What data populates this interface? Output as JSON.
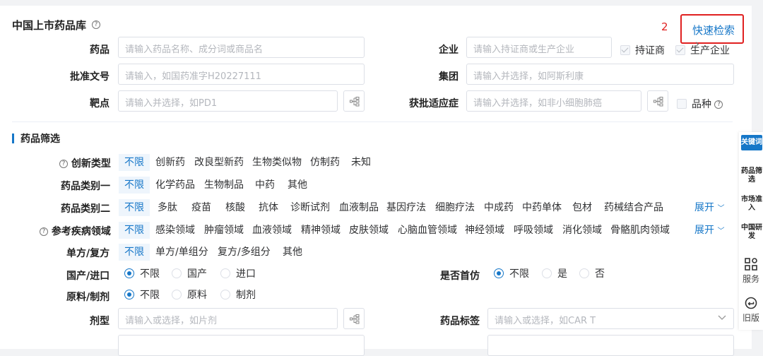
{
  "header": {
    "title": "中国上市药品库",
    "help": "?",
    "annotation": "2",
    "quick_search": "快速检索",
    "quick_search_arrow": "›"
  },
  "search": {
    "drug": {
      "label": "药品",
      "placeholder": "请输入药品名称、成分词或商品名"
    },
    "company": {
      "label": "企业",
      "placeholder": "请输入持证商或生产企业",
      "opt_holder": "持证商",
      "opt_manufacturer": "生产企业"
    },
    "approval": {
      "label": "批准文号",
      "placeholder": "请输入，如国药准字H20227111"
    },
    "group": {
      "label": "集团",
      "placeholder": "请输入并选择，如阿斯利康"
    },
    "target": {
      "label": "靶点",
      "placeholder": "请输入并选择，如PD1"
    },
    "indication": {
      "label": "获批适应症",
      "placeholder": "请输入并选择，如非小细胞肺癌",
      "variety": "品种"
    }
  },
  "filters": {
    "section_title": "药品筛选",
    "innovation": {
      "label": "创新类型",
      "options": [
        "不限",
        "创新药",
        "改良型新药",
        "生物类似物",
        "仿制药",
        "未知"
      ]
    },
    "cat1": {
      "label": "药品类别一",
      "options": [
        "不限",
        "化学药品",
        "生物制品",
        "中药",
        "其他"
      ]
    },
    "cat2": {
      "label": "药品类别二",
      "options": [
        "不限",
        "多肽",
        "疫苗",
        "核酸",
        "抗体",
        "诊断试剂",
        "血液制品",
        "基因疗法",
        "细胞疗法",
        "中成药",
        "中药单体",
        "包材",
        "药械结合产品"
      ],
      "expand": "展开"
    },
    "disease": {
      "label": "参考疾病领域",
      "options": [
        "不限",
        "感染领域",
        "肿瘤领域",
        "血液领域",
        "精神领域",
        "皮肤领域",
        "心脑血管领域",
        "神经领域",
        "呼吸领域",
        "消化领域",
        "骨骼肌肉领域"
      ],
      "expand": "展开"
    },
    "formula": {
      "label": "单方/复方",
      "options": [
        "不限",
        "单方/单组分",
        "复方/多组分",
        "其他"
      ]
    },
    "origin": {
      "label": "国产/进口",
      "options": [
        "不限",
        "国产",
        "进口"
      ]
    },
    "first_generic": {
      "label": "是否首仿",
      "options": [
        "不限",
        "是",
        "否"
      ]
    },
    "material": {
      "label": "原料/制剂",
      "options": [
        "不限",
        "原料",
        "制剂"
      ]
    },
    "dosage": {
      "label": "剂型",
      "placeholder": "请输入或选择，如片剂"
    },
    "tag": {
      "label": "药品标签",
      "placeholder": "请输入或选择，如CAR T"
    }
  },
  "sidebar": {
    "items": [
      {
        "label": "关键词"
      },
      {
        "label": "药品筛选"
      },
      {
        "label": "市场准入"
      },
      {
        "label": "中国研发"
      }
    ],
    "service": "服务",
    "old": "旧版"
  },
  "colors": {
    "accent": "#1677c8",
    "highlight_border": "#e02020"
  }
}
